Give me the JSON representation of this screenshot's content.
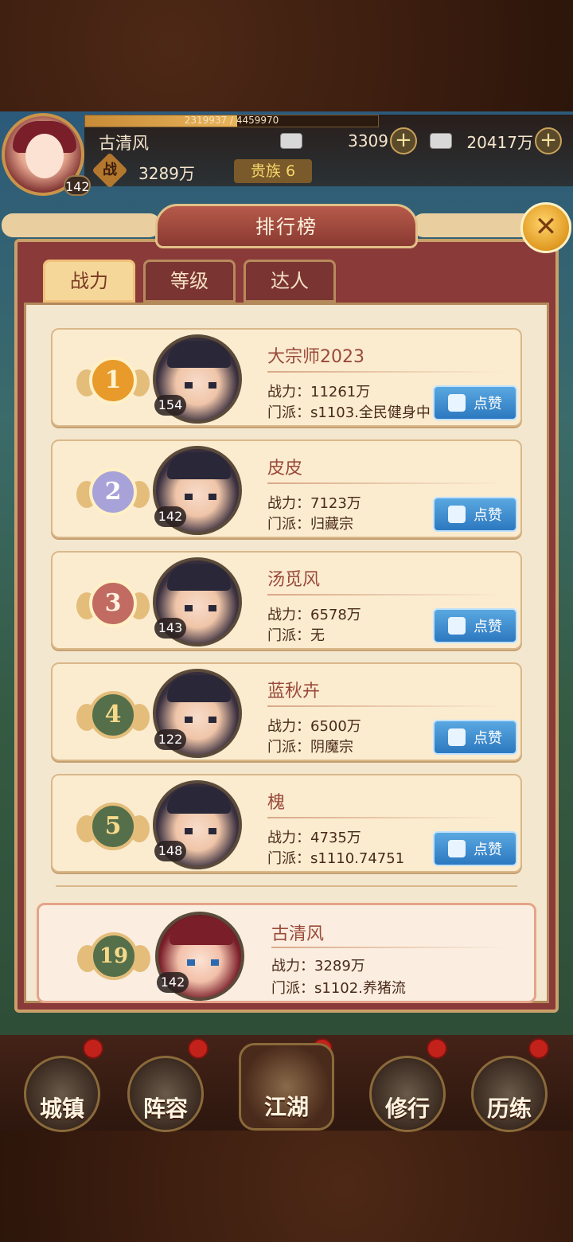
{
  "player": {
    "name": "古清风",
    "level": "142",
    "exp_text": "2319937 / 4459970",
    "exp_fraction": 0.52,
    "power_icon": "战",
    "power": "3289万",
    "noble": "贵族 6",
    "gold_ingot": "3309",
    "silver_ingot": "20417万"
  },
  "panel": {
    "title": "排行榜",
    "tabs": [
      {
        "label": "战力",
        "active": true
      },
      {
        "label": "等级",
        "active": false
      },
      {
        "label": "达人",
        "active": false
      }
    ]
  },
  "like_label": "点赞",
  "rankings": [
    {
      "rank": "1",
      "medal": "gold",
      "level": "154",
      "name": "大宗师2023",
      "power": "战力：11261万",
      "sect": "门派：s1103.全民健身中"
    },
    {
      "rank": "2",
      "medal": "silver",
      "level": "142",
      "name": "皮皮",
      "power": "战力：7123万",
      "sect": "门派：归藏宗"
    },
    {
      "rank": "3",
      "medal": "bronze",
      "level": "143",
      "name": "汤觅风",
      "power": "战力：6578万",
      "sect": "门派：无"
    },
    {
      "rank": "4",
      "medal": "plain",
      "level": "122",
      "name": "蓝秋卉",
      "power": "战力：6500万",
      "sect": "门派：阴魔宗"
    },
    {
      "rank": "5",
      "medal": "plain",
      "level": "148",
      "name": "槐",
      "power": "战力：4735万",
      "sect": "门派：s1110.74751"
    }
  ],
  "self_rank": {
    "rank": "19",
    "level": "142",
    "name": "古清风",
    "power": "战力：3289万",
    "sect": "门派：s1102.养猪流"
  },
  "nav": [
    {
      "label": "城镇"
    },
    {
      "label": "阵容"
    },
    {
      "label": "江湖"
    },
    {
      "label": "修行"
    },
    {
      "label": "历练"
    }
  ]
}
